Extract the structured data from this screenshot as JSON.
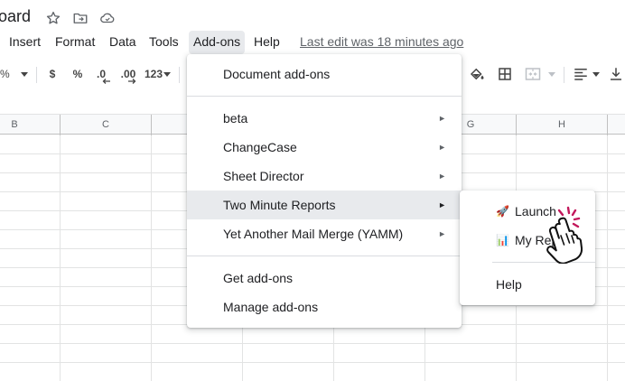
{
  "title": {
    "doc_title": "oard"
  },
  "menubar": {
    "items": [
      "Insert",
      "Format",
      "Data",
      "Tools",
      "Add-ons",
      "Help"
    ],
    "active": "Add-ons",
    "last_edit": "Last edit was 18 minutes ago"
  },
  "toolbar": {
    "zoom_fragment": "%",
    "currency": "$",
    "percent": "%",
    "decrease_decimal": ".0",
    "increase_decimal": ".00",
    "more_formats": "123"
  },
  "grid": {
    "columns": [
      "B",
      "C",
      "G",
      "H"
    ]
  },
  "addons_menu": {
    "document_addons": "Document add-ons",
    "addons": [
      "beta",
      "ChangeCase",
      "Sheet Director",
      "Two Minute Reports",
      "Yet Another Mail Merge (YAMM)"
    ],
    "highlighted": "Two Minute Reports",
    "get_addons": "Get add-ons",
    "manage_addons": "Manage add-ons",
    "submenu_arrow": "►"
  },
  "submenu": {
    "launch_emoji": "🚀",
    "launch": "Launch",
    "my_reports_emoji": "📊",
    "my_reports": "My Reports",
    "help": "Help"
  },
  "colors": {
    "highlight": "#e8eaed",
    "cursor_burst": "#c2185b"
  }
}
